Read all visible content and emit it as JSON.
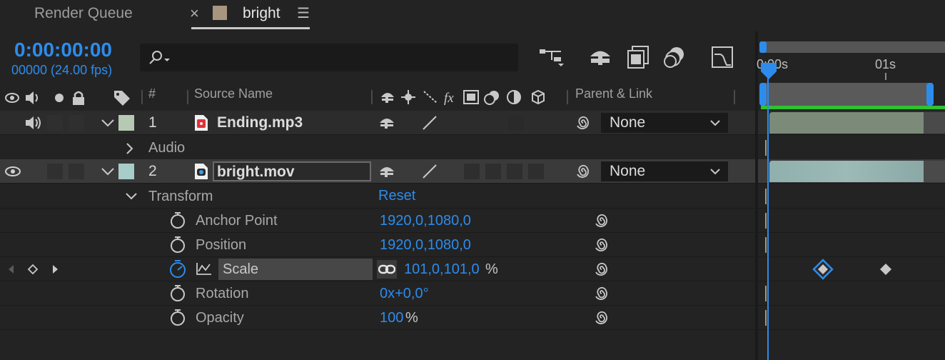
{
  "tabs": {
    "render_queue": "Render Queue",
    "close": "×",
    "comp_name": "bright",
    "menu": "☰"
  },
  "time": {
    "timecode": "0:00:00:00",
    "frames": "00000 (24.00 fps)"
  },
  "search": {
    "placeholder": ""
  },
  "ruler": {
    "start": "0:00s",
    "mark": "01s"
  },
  "headers": {
    "index": "#",
    "source_name": "Source Name",
    "parent_link": "Parent & Link",
    "fx": "fx"
  },
  "layers": [
    {
      "index": "1",
      "name": "Ending.mp3",
      "parent": "None",
      "label_color": "#b5c9b3"
    },
    {
      "index": "2",
      "name": "bright.mov",
      "parent": "None",
      "label_color": "#a8ccc8"
    }
  ],
  "groups": {
    "audio": "Audio",
    "transform": "Transform",
    "reset": "Reset"
  },
  "properties": {
    "anchor_point": {
      "label": "Anchor Point",
      "value": "1920,0,1080,0"
    },
    "position": {
      "label": "Position",
      "value": "1920,0,1080,0"
    },
    "scale": {
      "label": "Scale",
      "value": "101,0,101,0",
      "unit": "%"
    },
    "rotation": {
      "label": "Rotation",
      "value": "0x+0,0°"
    },
    "opacity": {
      "label": "Opacity",
      "value": "100",
      "unit": "%"
    }
  },
  "colors": {
    "accent": "#2d8ceb",
    "work_area": "#2fc12f",
    "audio_bar": "#7b8a79",
    "video_bar": "#8fb0ad"
  }
}
